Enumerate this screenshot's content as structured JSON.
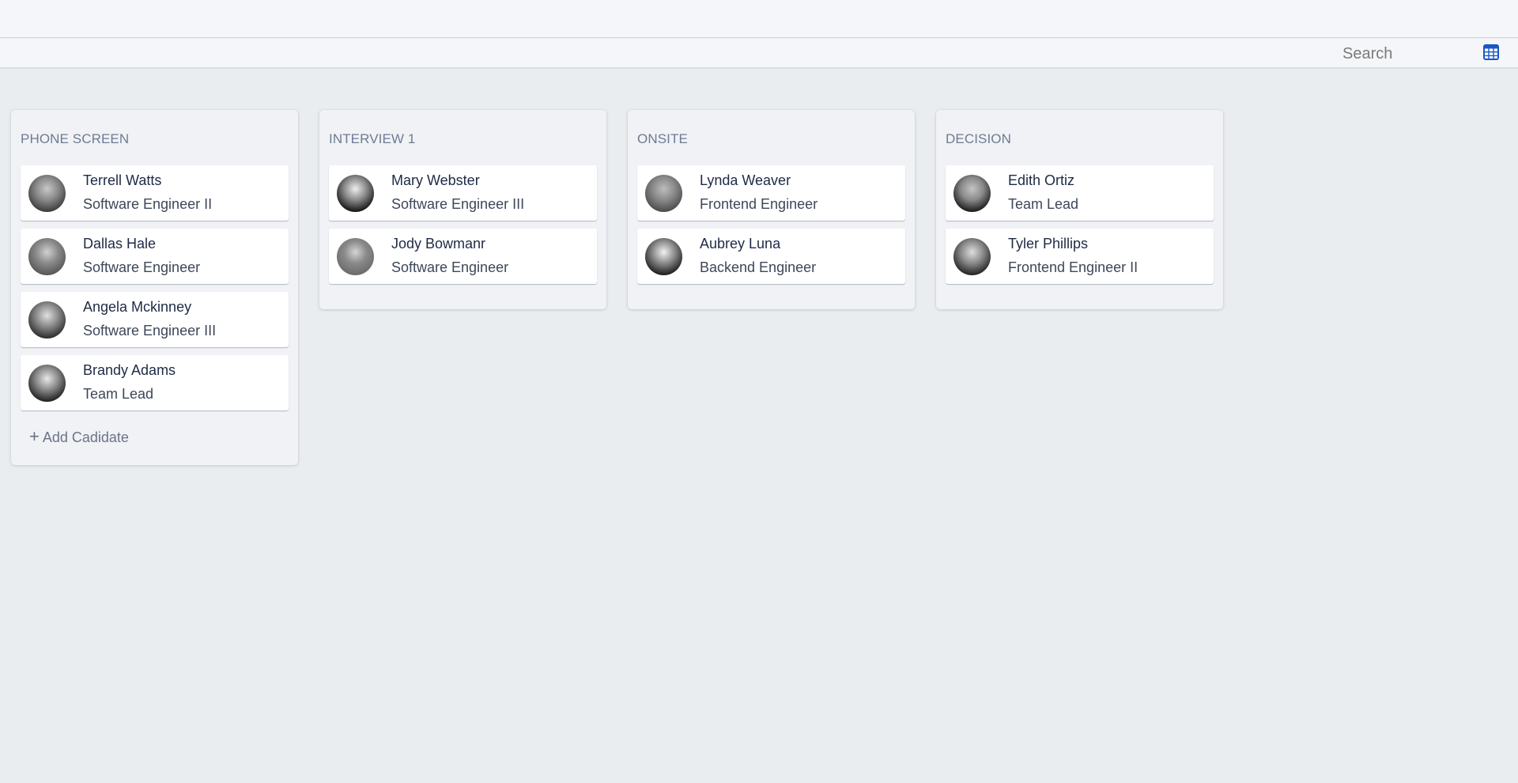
{
  "toolbar": {
    "search_placeholder": "Search",
    "view_icon": "table-grid-icon",
    "accent_color": "#1a56c4"
  },
  "columns": [
    {
      "title": "PHONE SCREEN",
      "cards": [
        {
          "name": "Terrell Watts",
          "role": "Software Engineer II",
          "avatar_tone": [
            "#c8c8c8",
            "#3a3a3a"
          ]
        },
        {
          "name": "Dallas Hale",
          "role": "Software Engineer",
          "avatar_tone": [
            "#d0d0d0",
            "#555555"
          ]
        },
        {
          "name": "Angela Mckinney",
          "role": "Software Engineer III",
          "avatar_tone": [
            "#e0e0e0",
            "#2a2a2a"
          ]
        },
        {
          "name": "Brandy Adams",
          "role": "Team Lead",
          "avatar_tone": [
            "#e8e8e8",
            "#1e1e1e"
          ]
        }
      ],
      "add_label": "Add Cadidate",
      "add_icon": "plus-icon"
    },
    {
      "title": "INTERVIEW 1",
      "cards": [
        {
          "name": "Mary Webster",
          "role": "Software Engineer III",
          "avatar_tone": [
            "#eeeeee",
            "#111111"
          ]
        },
        {
          "name": "Jody Bowmanr",
          "role": "Software Engineer",
          "avatar_tone": [
            "#d4d4d4",
            "#6a6a6a"
          ]
        }
      ]
    },
    {
      "title": "ONSITE",
      "cards": [
        {
          "name": "Lynda Weaver",
          "role": "Frontend Engineer",
          "avatar_tone": [
            "#bdbdbd",
            "#4a4a4a"
          ]
        },
        {
          "name": "Aubrey Luna",
          "role": "Backend Engineer",
          "avatar_tone": [
            "#f2f2f2",
            "#1a1a1a"
          ]
        }
      ]
    },
    {
      "title": "DECISION",
      "cards": [
        {
          "name": "Edith Ortiz",
          "role": "Team Lead",
          "avatar_tone": [
            "#c4c4c4",
            "#181818"
          ]
        },
        {
          "name": "Tyler Phillips",
          "role": "Frontend Engineer II",
          "avatar_tone": [
            "#dedede",
            "#202020"
          ]
        }
      ]
    }
  ]
}
